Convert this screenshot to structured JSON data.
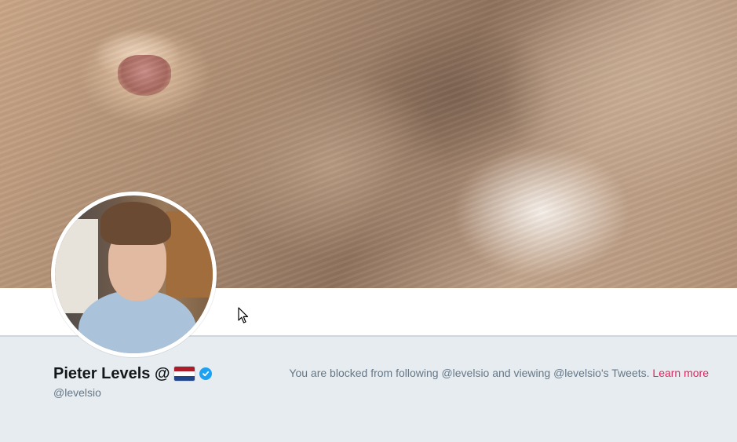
{
  "profile": {
    "display_name": "Pieter Levels @",
    "handle": "@levelsio",
    "flag_icon": "netherlands-flag-icon",
    "verified_icon": "verified-badge-icon"
  },
  "blocked_notice": {
    "text": "You are blocked from following @levelsio and viewing @levelsio's Tweets.",
    "link_label": "Learn more",
    "link_color": "#e0245e"
  },
  "colors": {
    "verified": "#1da1f2",
    "page_background": "#e6ecf0",
    "secondary_text": "#657786"
  }
}
